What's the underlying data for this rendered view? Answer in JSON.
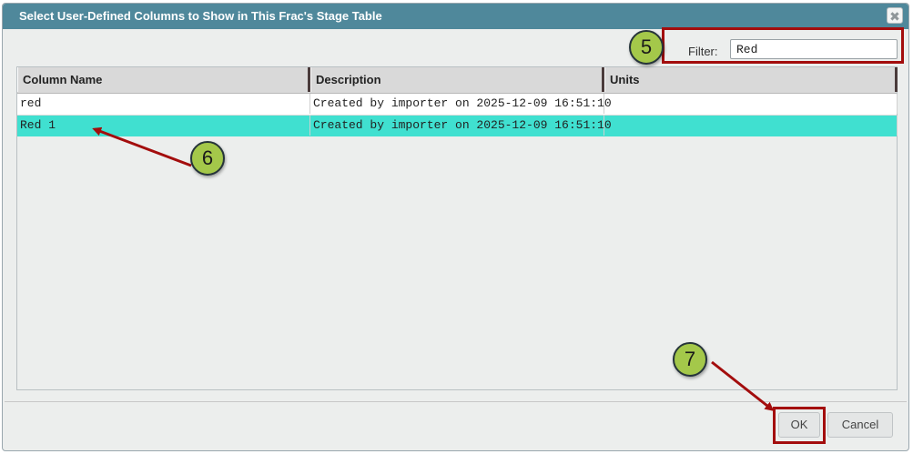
{
  "dialog": {
    "title": "Select User-Defined Columns to Show in This Frac's Stage Table",
    "close_glyph": "✖"
  },
  "filter": {
    "label": "Filter:",
    "value": "Red"
  },
  "table": {
    "columns": [
      "Column Name",
      "Description",
      "Units"
    ],
    "rows": [
      {
        "name": "red",
        "description": "Created by importer on 2025-12-09 16:51:10",
        "units": "",
        "selected": false
      },
      {
        "name": "Red 1",
        "description": "Created by importer on 2025-12-09 16:51:10",
        "units": "",
        "selected": true
      }
    ]
  },
  "buttons": {
    "ok": "OK",
    "cancel": "Cancel"
  },
  "callouts": {
    "filter": "5",
    "row": "6",
    "ok": "7"
  },
  "colors": {
    "titlebar": "#4f889b",
    "selected_row": "#40e0d0",
    "annotation_red": "#a30d0d",
    "callout_green": "#a4c84a"
  }
}
